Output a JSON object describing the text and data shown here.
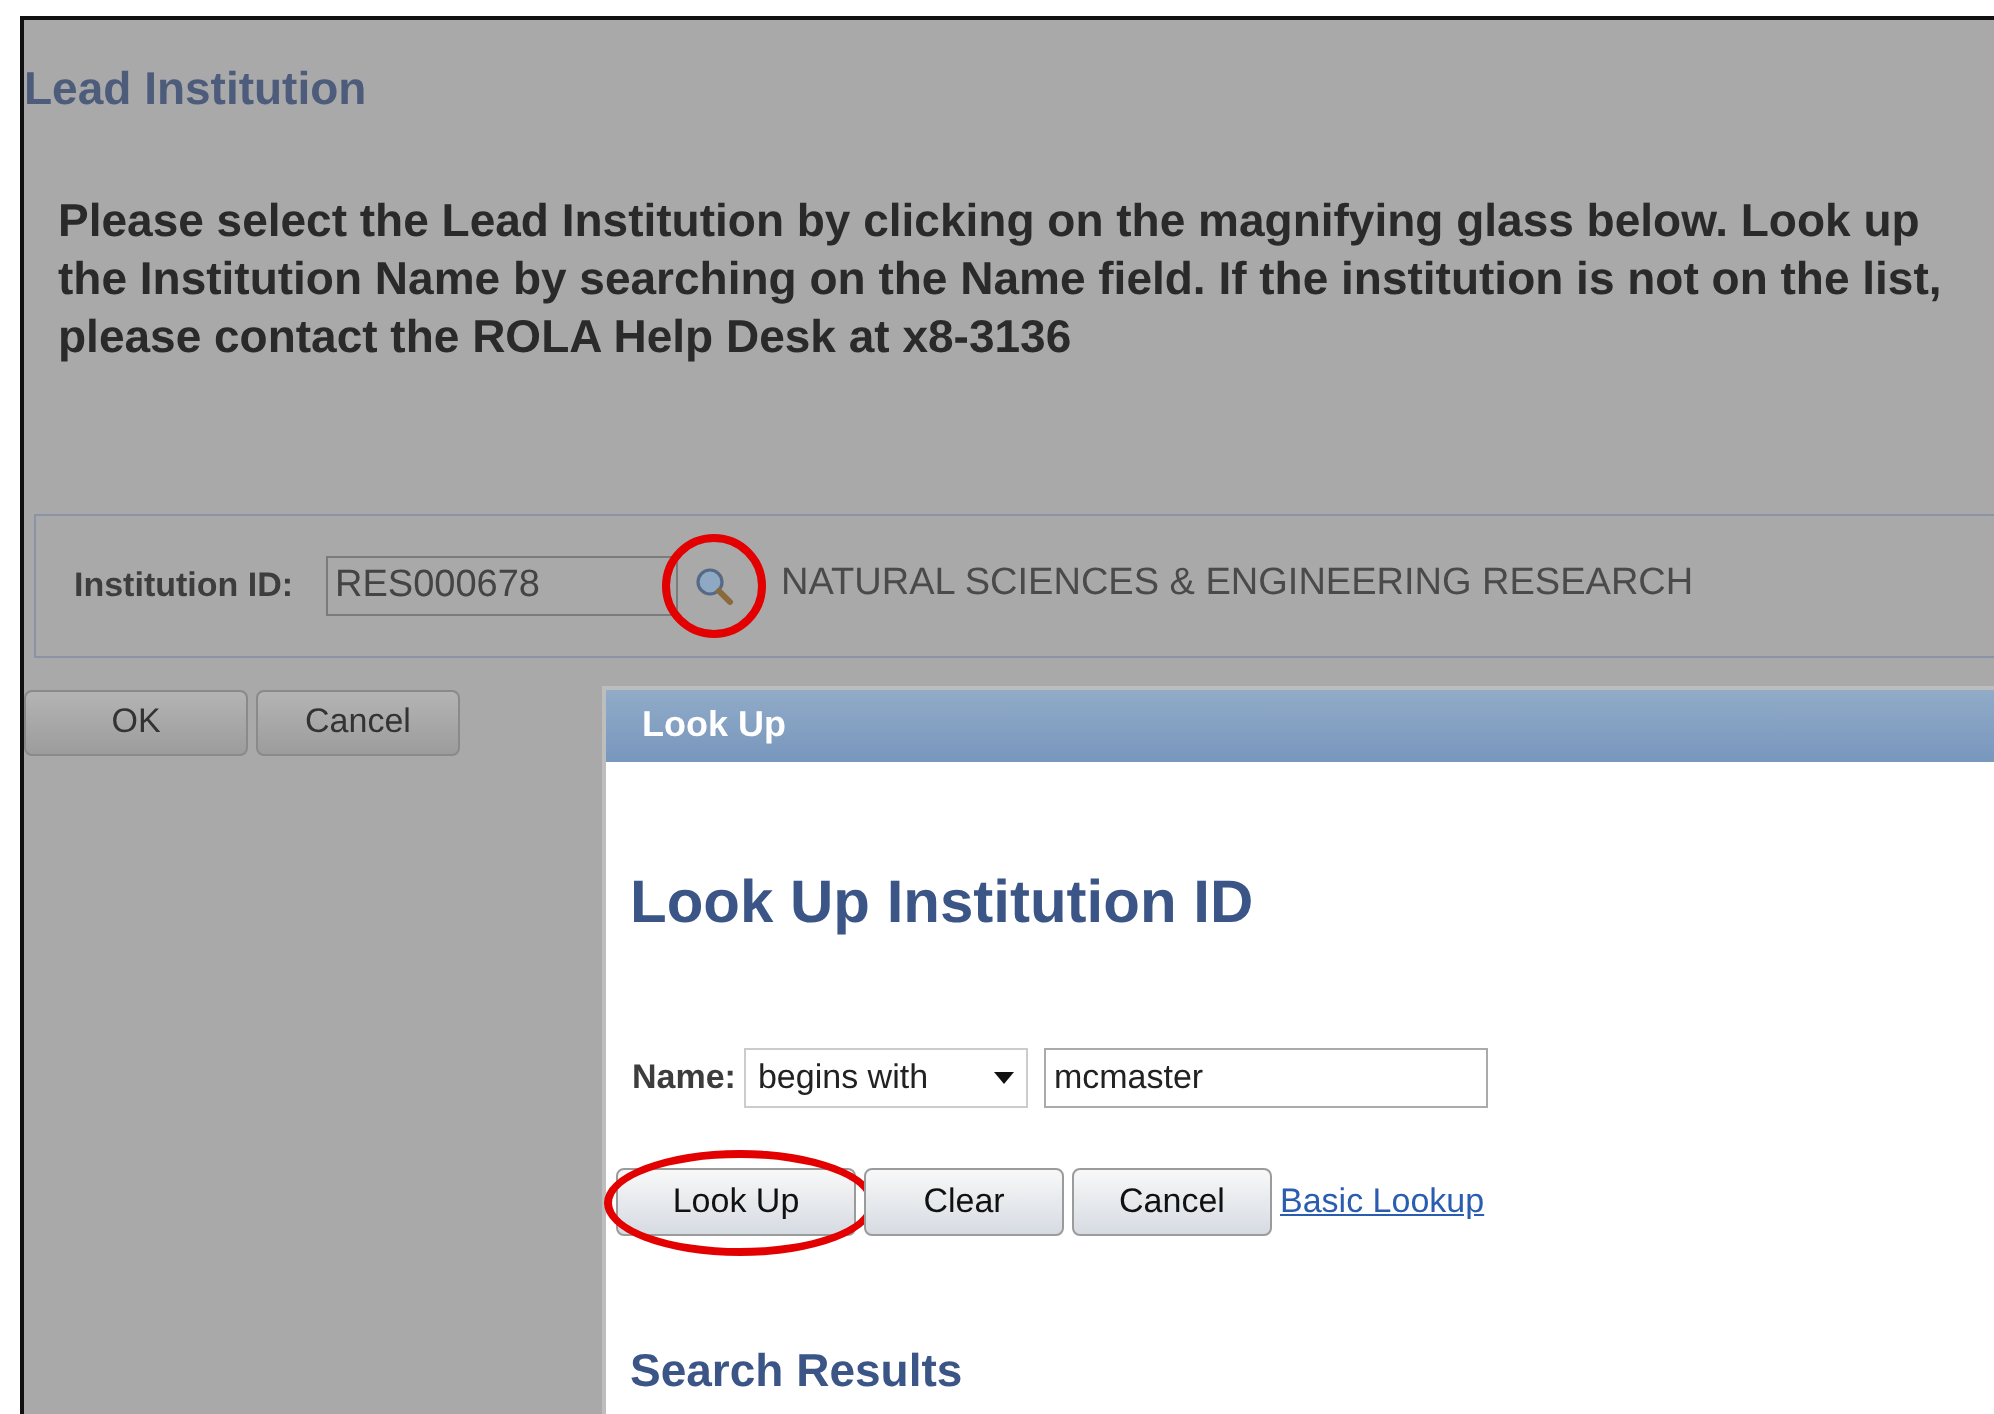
{
  "page": {
    "title": "Lead Institution",
    "instructions": "Please select the Lead Institution by clicking on the magnifying glass below. Look up the Institution Name by searching on the Name field. If the institution is not on the list, please contact the ROLA Help Desk at x8-3136"
  },
  "institution_field": {
    "label": "Institution ID:",
    "value": "RES000678",
    "lookup_highlighted": true,
    "description": "NATURAL SCIENCES &  ENGINEERING RESEARCH"
  },
  "buttons": [
    {
      "label": "OK"
    },
    {
      "label": "Cancel"
    }
  ],
  "lookup_dialog": {
    "title": "Look Up",
    "heading": "Look Up Institution ID",
    "name_label": "Name:",
    "operator": "begins with",
    "value": "mcmaster",
    "actions": [
      {
        "kind": "button",
        "label": "Look Up",
        "highlighted": true
      },
      {
        "kind": "button",
        "label": "Clear",
        "highlighted": false
      },
      {
        "kind": "button",
        "label": "Cancel",
        "highlighted": false
      },
      {
        "kind": "link",
        "label": "Basic Lookup",
        "highlighted": false
      }
    ],
    "results_heading": "Search Results"
  }
}
